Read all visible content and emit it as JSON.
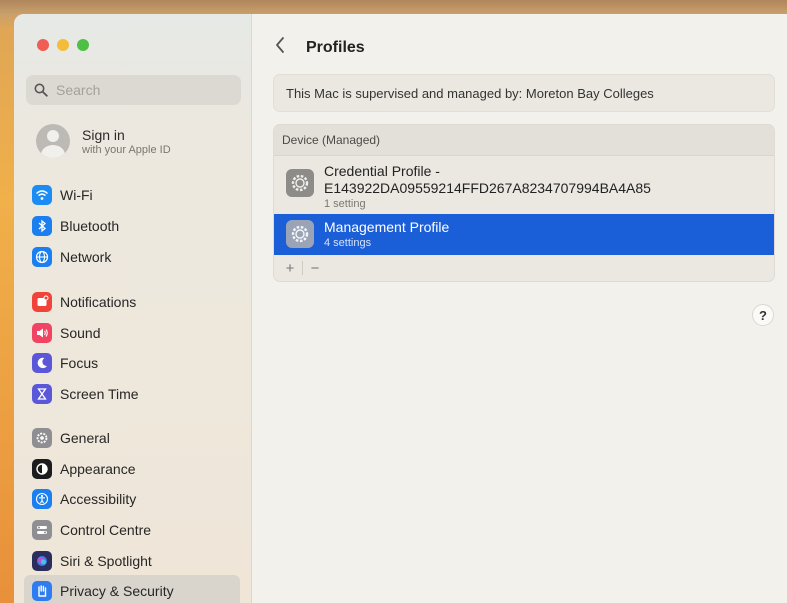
{
  "window": {
    "traffic_lights": {
      "close": "#ee5e55",
      "minimize": "#f4bc3b",
      "zoom": "#4fc046"
    }
  },
  "sidebar": {
    "search": {
      "placeholder": "Search",
      "icon": "magnifying-glass"
    },
    "account": {
      "title": "Sign in",
      "subtitle": "with your Apple ID"
    },
    "items": [
      {
        "label": "Wi-Fi",
        "icon": "wifi-icon",
        "color": "#1b8cf3"
      },
      {
        "label": "Bluetooth",
        "icon": "bluetooth-icon",
        "color": "#1b7ff0"
      },
      {
        "label": "Network",
        "icon": "globe-icon",
        "color": "#1b7ff0"
      },
      {
        "label": "Notifications",
        "icon": "bell-icon",
        "color": "#f0443a"
      },
      {
        "label": "Sound",
        "icon": "speaker-icon",
        "color": "#f04462"
      },
      {
        "label": "Focus",
        "icon": "moon-icon",
        "color": "#5b57d9"
      },
      {
        "label": "Screen Time",
        "icon": "hourglass-icon",
        "color": "#5b57d9"
      },
      {
        "label": "General",
        "icon": "gear-icon",
        "color": "#8e8e93"
      },
      {
        "label": "Appearance",
        "icon": "appearance-icon",
        "color": "#1c1c1e"
      },
      {
        "label": "Accessibility",
        "icon": "accessibility-icon",
        "color": "#1b7ff0"
      },
      {
        "label": "Control Centre",
        "icon": "control-centre-icon",
        "color": "#8e8e93"
      },
      {
        "label": "Siri & Spotlight",
        "icon": "siri-icon",
        "color": "#2b2d5c"
      },
      {
        "label": "Privacy & Security",
        "icon": "hand-icon",
        "color": "#2f7cf0",
        "selected": true
      }
    ]
  },
  "main": {
    "title": "Profiles",
    "supervised_text": "This Mac is supervised and managed by: Moreton Bay Colleges",
    "group": {
      "header": "Device (Managed)",
      "profiles": [
        {
          "name_line1": "Credential Profile -",
          "name_line2": "E143922DA09559214FFD267A8234707994BA4A85",
          "settings": "1 setting"
        },
        {
          "name": "Management Profile",
          "settings": "4 settings",
          "selected": true
        }
      ],
      "add_label": "+",
      "remove_label": "−"
    },
    "help_label": "?"
  }
}
